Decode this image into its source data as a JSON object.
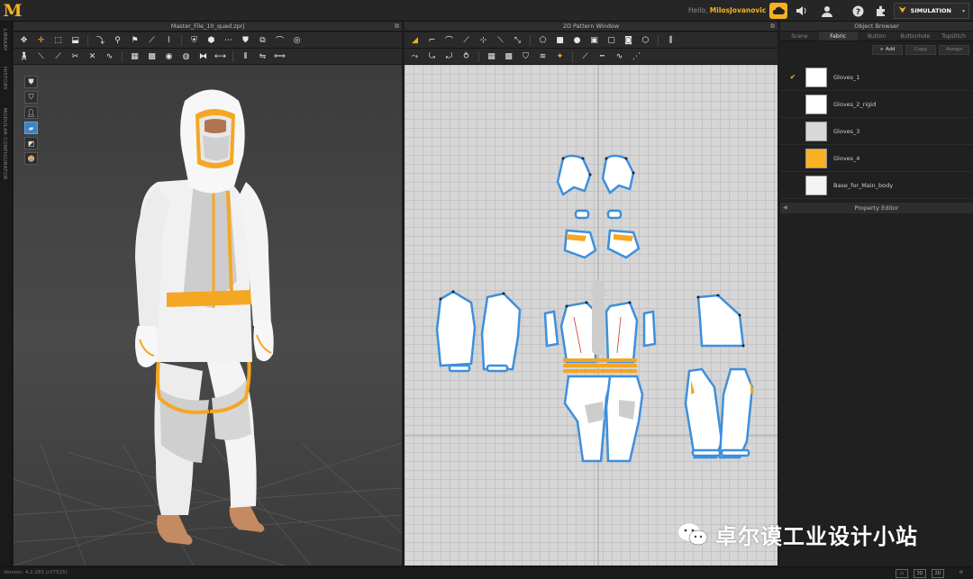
{
  "app": {
    "logo_text": "M",
    "greeting_prefix": "Hello, ",
    "user_name": "MilosJovanovic",
    "simulation_label": "SIMULATION"
  },
  "side_tabs": [
    "LIBRARY",
    "HISTORY",
    "MODULAR CONFIGURATOR"
  ],
  "viewport3d": {
    "title": "Master_File_10_quad.zprj",
    "maximize_glyph": "⧉"
  },
  "viewport2d": {
    "title": "2D Pattern Window",
    "maximize_glyph": "⧉"
  },
  "object_browser": {
    "title": "Object Browser",
    "tabs": [
      "Scene",
      "Fabric",
      "Button",
      "Buttonhole",
      "Topstitch"
    ],
    "active_tab": "Fabric",
    "buttons": {
      "add": "+ Add",
      "copy": "Copy",
      "assign": "Assign"
    },
    "fabrics": [
      {
        "name": "Gloves_1",
        "color": "#ffffff",
        "checked": true
      },
      {
        "name": "Gloves_2_rigid",
        "color": "#ffffff",
        "checked": false
      },
      {
        "name": "Gloves_3",
        "color": "#d8d8d8",
        "checked": false
      },
      {
        "name": "Gloves_4",
        "color": "#f9b122",
        "checked": false
      },
      {
        "name": "Base_for_Main_body",
        "color": "#f4f4f4",
        "checked": false
      }
    ],
    "check_glyph": "✔"
  },
  "property_editor": {
    "title": "Property Editor"
  },
  "status": {
    "version": "Version: 4.2.283 (r37525)"
  },
  "watermark": {
    "text": "卓尔谟工业设计小站"
  },
  "colors": {
    "accent": "#f5b025",
    "selection_blue": "#3b82c4"
  }
}
